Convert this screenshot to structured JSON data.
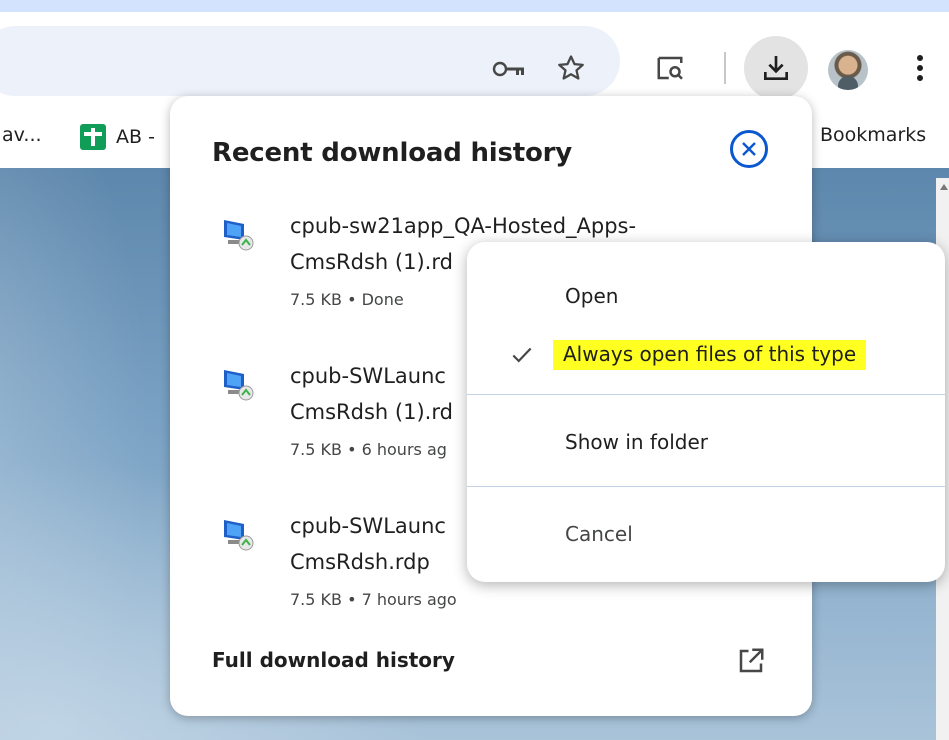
{
  "bookmarks": {
    "left_partial": "av...",
    "ab_label": "AB -",
    "right_label": "Bookmarks"
  },
  "panel": {
    "title": "Recent download history",
    "items": [
      {
        "name_line1": "cpub-sw21app_QA-Hosted_Apps-",
        "name_line2": "CmsRdsh (1).rd",
        "meta": "7.5 KB • Done"
      },
      {
        "name_line1": "cpub-SWLaunc",
        "name_line2": "CmsRdsh (1).rd",
        "meta": "7.5 KB • 6 hours ag"
      },
      {
        "name_line1": "cpub-SWLaunc",
        "name_line2": "CmsRdsh.rdp",
        "meta": "7.5 KB • 7 hours ago"
      }
    ],
    "full_history": "Full download history"
  },
  "context_menu": {
    "open": "Open",
    "always_open": "Always open files of this type",
    "show_in_folder": "Show in folder",
    "cancel": "Cancel"
  },
  "colors": {
    "accent_blue": "#0b57d0",
    "highlight": "#ffff22",
    "omnibox": "#edf2fa"
  },
  "icons": [
    "key-icon",
    "star-icon",
    "tab-search-icon",
    "download-icon",
    "avatar",
    "more-menu-icon",
    "sheets-icon",
    "close-icon",
    "rdp-file-icon",
    "check-icon",
    "external-link-icon"
  ]
}
